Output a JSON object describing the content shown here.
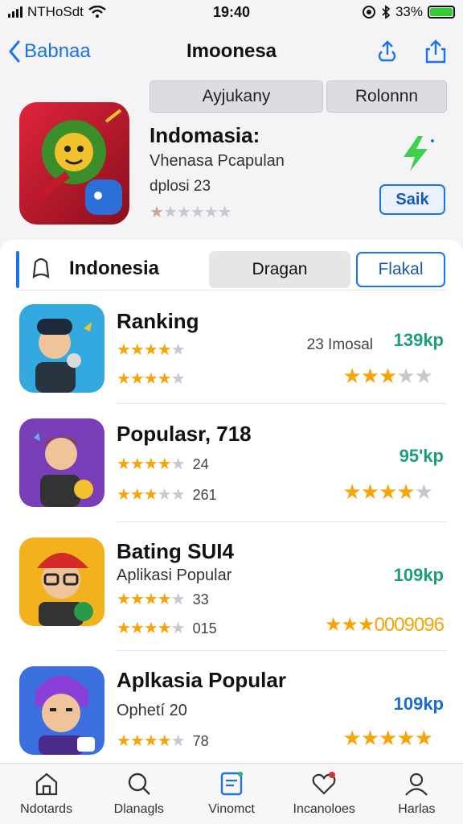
{
  "status": {
    "carrier": "NTHoSdt",
    "time": "19:40",
    "battery": "33%"
  },
  "nav": {
    "back_label": "Babnaa",
    "title": "Imoonesa"
  },
  "header": {
    "seg": [
      "Ayjukany",
      "Rolonnn"
    ],
    "app_name": "Indomasia:",
    "app_sub": "Vhenasa Pcapulan",
    "app_meta": "dplosi 23",
    "stars": "★★★★★",
    "action_label": "Saik"
  },
  "filter": {
    "label": "Indonesia",
    "btn1": "Dragan",
    "btn2": "Flakal"
  },
  "rows": [
    {
      "title": "Ranking",
      "stars1": "★★★★",
      "stars1_off": "★",
      "stars2": "★★★★",
      "stars2_off": "★",
      "count1": "",
      "count2": "",
      "desc": "23 Imosal",
      "price": "139kp",
      "bigstars": "★★★",
      "bigstars_off": "★★",
      "price_color": "green"
    },
    {
      "title": "Populasr, 718",
      "stars1": "★★★★",
      "stars1_off": "★",
      "stars2": "★★★",
      "stars2_off": "★★",
      "count1": "24",
      "count2": "261",
      "desc": "",
      "price": "95'kp",
      "bigstars": "★★★★",
      "bigstars_off": "★",
      "price_color": "green"
    },
    {
      "title": "Bating SUI4",
      "sub": "Aplikasi Popular",
      "stars1": "★★★★",
      "stars1_off": "★",
      "stars2": "★★★★",
      "stars2_off": "★",
      "count1": "33",
      "count2": "015",
      "desc": "",
      "price": "109kp",
      "bigstars_text": "★★★0009096",
      "price_color": "green"
    },
    {
      "title": "Aplkasia Popular",
      "sub": "Ophetí 20",
      "stars1": "★★★★",
      "stars1_off": "★",
      "count1": "78",
      "desc": "",
      "price": "109kp",
      "bigstars": "★★★★★",
      "bigstars_off": "",
      "price_color": "blue"
    }
  ],
  "tabs": [
    "Ndotards",
    "Dlanagls",
    "Vinomct",
    "Incanoloes",
    "Harlas"
  ]
}
